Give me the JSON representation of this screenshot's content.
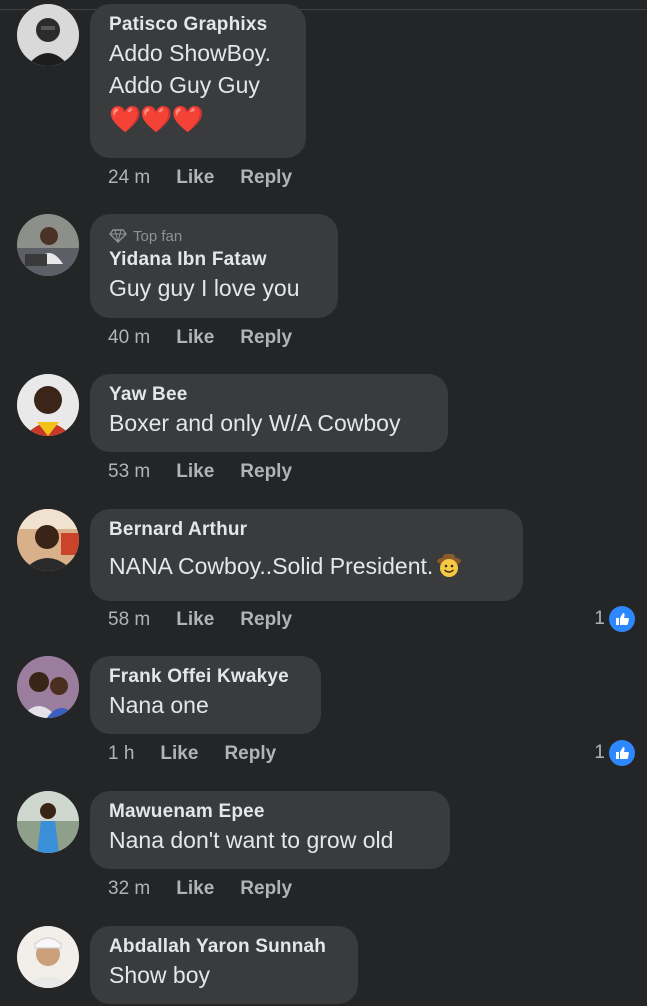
{
  "comments": [
    {
      "name": "Patisco Graphixs",
      "top_fan": "",
      "lines": [
        "Addo ShowBoy.",
        "Addo Guy Guy"
      ],
      "hearts": "❤️❤️❤️",
      "time": "24 m",
      "like": "Like",
      "reply": "Reply",
      "reactions": ""
    },
    {
      "name": "Yidana Ibn Fataw",
      "top_fan": "Top fan",
      "lines": [
        "Guy guy I love you"
      ],
      "time": "40 m",
      "like": "Like",
      "reply": "Reply",
      "reactions": ""
    },
    {
      "name": "Yaw Bee",
      "top_fan": "",
      "lines": [
        "Boxer and only W/A Cowboy"
      ],
      "time": "53 m",
      "like": "Like",
      "reply": "Reply",
      "reactions": ""
    },
    {
      "name": "Bernard Arthur",
      "top_fan": "",
      "lines": [
        "NANA Cowboy..Solid President."
      ],
      "emoji": "cowboy-face-emoji",
      "time": "58 m",
      "like": "Like",
      "reply": "Reply",
      "reactions": "1"
    },
    {
      "name": "Frank Offei Kwakye",
      "top_fan": "",
      "lines": [
        "Nana one"
      ],
      "time": "1 h",
      "like": "Like",
      "reply": "Reply",
      "reactions": "1"
    },
    {
      "name": "Mawuenam Epee",
      "top_fan": "",
      "lines": [
        "Nana don't want to grow old"
      ],
      "time": "32 m",
      "like": "Like",
      "reply": "Reply",
      "reactions": ""
    },
    {
      "name": "Abdallah Yaron Sunnah",
      "top_fan": "",
      "lines": [
        "Show boy"
      ],
      "time": "",
      "like": "",
      "reply": "",
      "reactions": ""
    }
  ],
  "colors": {
    "background": "#242526",
    "bubble": "#3a3b3c",
    "text": "#e4e6eb",
    "muted": "#b0b3b8",
    "like_blue": "#2d88ff"
  },
  "icons": {
    "reaction": "thumbs-up-icon",
    "top_fan": "diamond-icon"
  }
}
